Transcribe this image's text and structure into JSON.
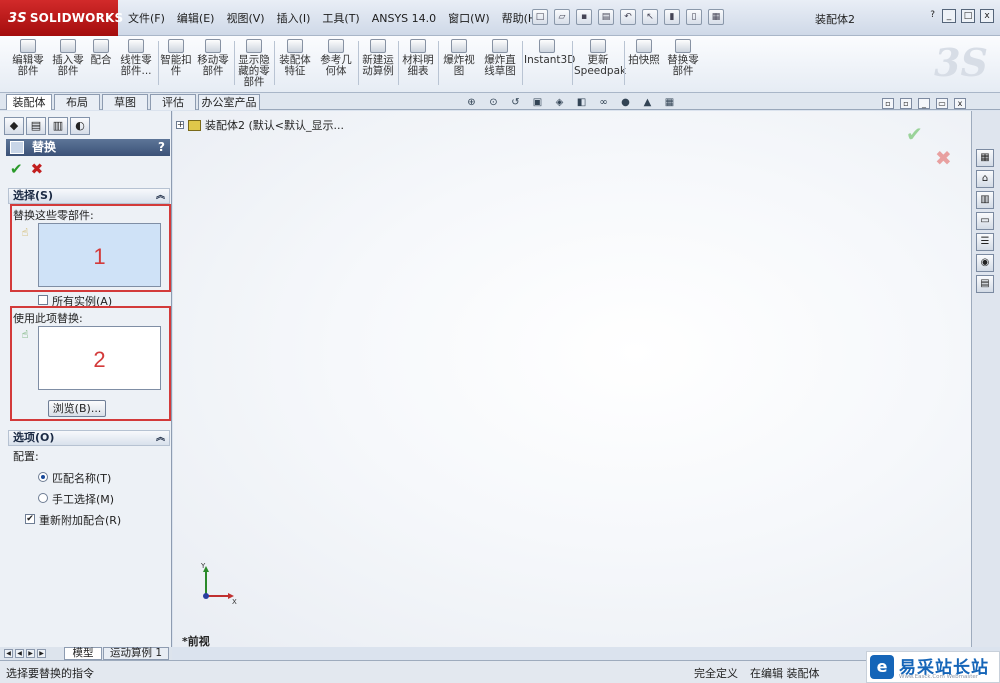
{
  "app": {
    "logo_text": "SOLIDWORKS",
    "logo_mark": "3S",
    "document_title": "装配体2"
  },
  "menu": [
    "文件(F)",
    "编辑(E)",
    "视图(V)",
    "插入(I)",
    "工具(T)",
    "ANSYS 14.0",
    "窗口(W)",
    "帮助(H)"
  ],
  "window_controls": {
    "help": "?",
    "minimize": "_",
    "restore": "□",
    "close": "x"
  },
  "ribbon": {
    "commands": [
      "编辑零部件",
      "插入零部件",
      "配合",
      "线性零部件...",
      "智能扣件",
      "移动零部件",
      "显示隐藏的零部件",
      "装配体特征",
      "参考几何体",
      "新建运动算例",
      "材料明细表",
      "爆炸视图",
      "爆炸直线草图",
      "Instant3D",
      "更新Speedpak",
      "拍快照",
      "替换零部件"
    ]
  },
  "command_tabs": [
    "装配体",
    "布局",
    "草图",
    "评估",
    "办公室产品"
  ],
  "tree": {
    "root_label": "装配体2  (默认<默认_显示..."
  },
  "property_manager": {
    "title": "替换",
    "help": "?",
    "selection_group": {
      "title": "选择(S)",
      "replace_label": "替换这些零部件:",
      "all_instances_label": "所有实例(A)",
      "all_instances_checked": false,
      "with_label": "使用此项替换:",
      "browse_label": "浏览(B)..."
    },
    "options_group": {
      "title": "选项(O)",
      "config_label": "配置:",
      "radio_match_name": "匹配名称(T)",
      "radio_manual": "手工选择(M)",
      "remate_label": "重新附加配合(R)",
      "remate_checked": true
    }
  },
  "annotations": {
    "box1": "1",
    "box2": "2"
  },
  "bottom_tabs": [
    "模型",
    "运动算例 1"
  ],
  "viewport": {
    "view_label": "*前视",
    "triad_x": "X",
    "triad_y": "Y"
  },
  "status": {
    "message": "选择要替换的指令",
    "definition": "完全定义",
    "editing": "在编辑 装配体"
  },
  "watermark": {
    "text": "易采站长站",
    "sub": "Www.Easck.Com Webmaster",
    "mark": "e"
  },
  "colors": {
    "accent_red": "#d33a3a",
    "header_blue": "#3c5277",
    "ok_green": "#2a9a2a"
  }
}
